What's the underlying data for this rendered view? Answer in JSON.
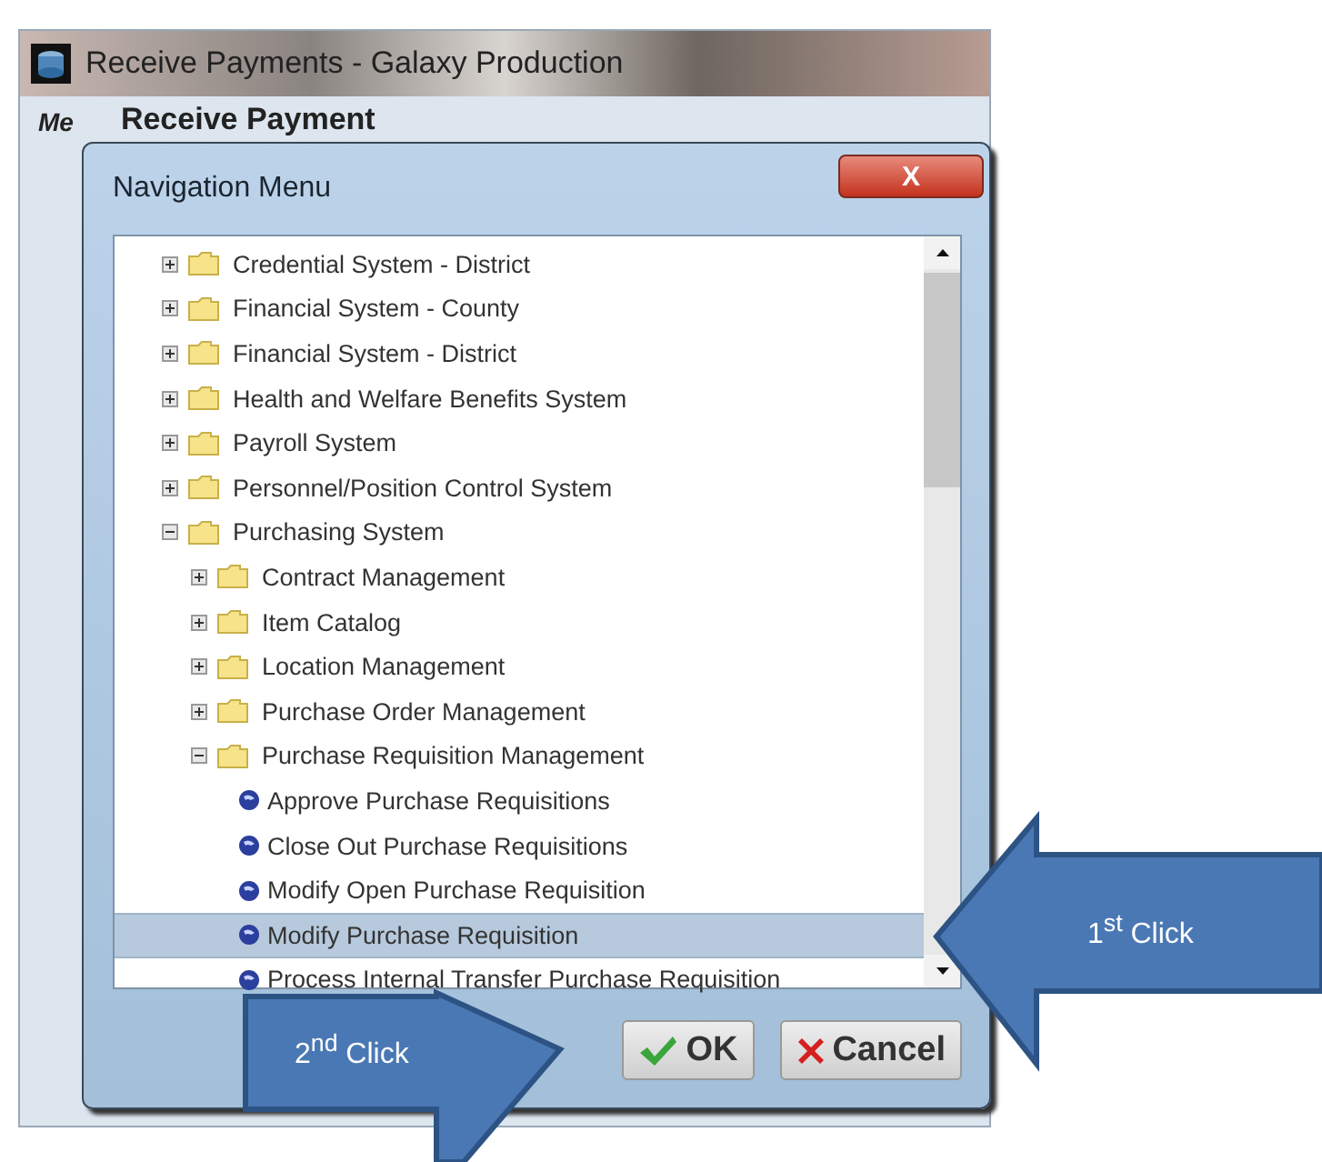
{
  "window": {
    "title": "Receive Payments - Galaxy Production",
    "tab": "Me",
    "heading": "Receive Payment"
  },
  "dialog": {
    "title": "Navigation Menu",
    "close": "X",
    "tree": [
      {
        "label": "Credential System - District",
        "kind": "folder",
        "expanded": false,
        "selected": false
      },
      {
        "label": "Financial System - County",
        "kind": "folder",
        "expanded": false,
        "selected": false
      },
      {
        "label": "Financial System - District",
        "kind": "folder",
        "expanded": false,
        "selected": false
      },
      {
        "label": "Health and Welfare Benefits System",
        "kind": "folder",
        "expanded": false,
        "selected": false
      },
      {
        "label": "Payroll System",
        "kind": "folder",
        "expanded": false,
        "selected": false
      },
      {
        "label": "Personnel/Position Control System",
        "kind": "folder",
        "expanded": false,
        "selected": false
      },
      {
        "label": "Purchasing System",
        "kind": "folder",
        "expanded": true,
        "selected": false,
        "children": [
          {
            "label": "Contract Management",
            "kind": "folder",
            "expanded": false,
            "selected": false
          },
          {
            "label": "Item Catalog",
            "kind": "folder",
            "expanded": false,
            "selected": false
          },
          {
            "label": "Location Management",
            "kind": "folder",
            "expanded": false,
            "selected": false
          },
          {
            "label": "Purchase Order Management",
            "kind": "folder",
            "expanded": false,
            "selected": false
          },
          {
            "label": "Purchase Requisition Management",
            "kind": "folder",
            "expanded": true,
            "selected": false,
            "children": [
              {
                "label": "Approve Purchase Requisitions",
                "kind": "leaf",
                "selected": false
              },
              {
                "label": "Close Out Purchase Requisitions",
                "kind": "leaf",
                "selected": false
              },
              {
                "label": "Modify Open Purchase Requisition",
                "kind": "leaf",
                "selected": false
              },
              {
                "label": "Modify Purchase Requisition",
                "kind": "leaf",
                "selected": true
              },
              {
                "label": "Process Internal Transfer Purchase Requisition",
                "kind": "leaf",
                "selected": false
              }
            ]
          }
        ]
      }
    ],
    "buttons": [
      {
        "label": "OK",
        "kind": "ok"
      },
      {
        "label": "Cancel",
        "kind": "cancel"
      }
    ]
  },
  "annotations": [
    {
      "label": "1$^{st}$ Click",
      "kind": "left"
    },
    {
      "label": "2$^{nd}$ Click",
      "kind": "right"
    }
  ]
}
